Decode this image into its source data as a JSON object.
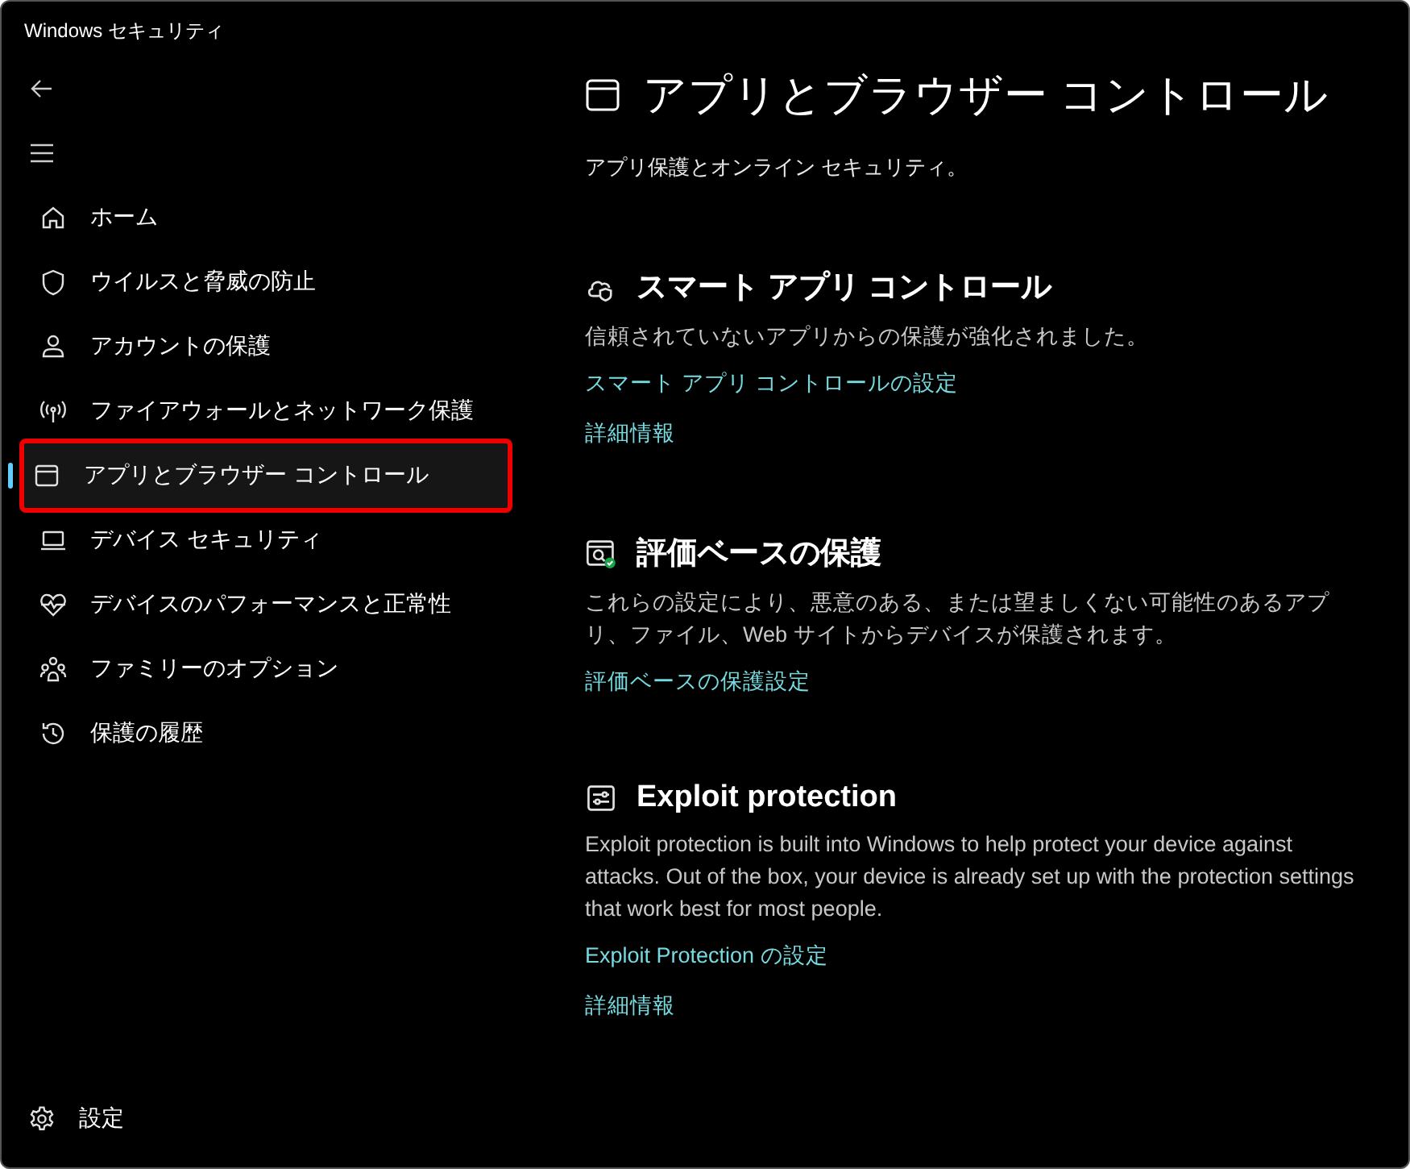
{
  "window": {
    "title": "Windows セキュリティ"
  },
  "sidebar": {
    "items": [
      {
        "label": "ホーム",
        "selected": false,
        "highlighted": false
      },
      {
        "label": "ウイルスと脅威の防止",
        "selected": false,
        "highlighted": false
      },
      {
        "label": "アカウントの保護",
        "selected": false,
        "highlighted": false
      },
      {
        "label": "ファイアウォールとネットワーク保護",
        "selected": false,
        "highlighted": false
      },
      {
        "label": "アプリとブラウザー コントロール",
        "selected": true,
        "highlighted": true
      },
      {
        "label": "デバイス セキュリティ",
        "selected": false,
        "highlighted": false
      },
      {
        "label": "デバイスのパフォーマンスと正常性",
        "selected": false,
        "highlighted": false
      },
      {
        "label": "ファミリーのオプション",
        "selected": false,
        "highlighted": false
      },
      {
        "label": "保護の履歴",
        "selected": false,
        "highlighted": false
      }
    ],
    "settings": "設定"
  },
  "page": {
    "title": "アプリとブラウザー コントロール",
    "subtitle": "アプリ保護とオンライン セキュリティ。"
  },
  "sections": [
    {
      "title": "スマート アプリ コントロール",
      "description": "信頼されていないアプリからの保護が強化されました。",
      "links": [
        "スマート アプリ コントロールの設定",
        "詳細情報"
      ]
    },
    {
      "title": "評価ベースの保護",
      "description": "これらの設定により、悪意のある、または望ましくない可能性のあるアプリ、ファイル、Web サイトからデバイスが保護されます。",
      "links": [
        "評価ベースの保護設定"
      ]
    },
    {
      "title": "Exploit protection",
      "description": "Exploit protection is built into Windows to help protect your device against attacks. Out of the box, your device is already set up with the protection settings that work best for most people.",
      "links": [
        "Exploit Protection の設定",
        "詳細情報"
      ]
    }
  ]
}
